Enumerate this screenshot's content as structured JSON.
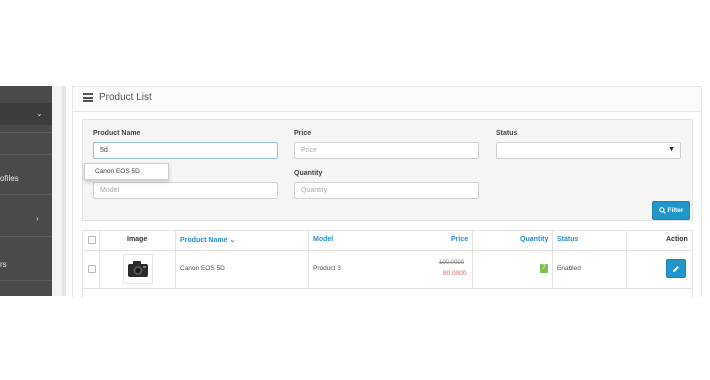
{
  "sidebar": {
    "items": [
      {
        "label": ""
      },
      {
        "label": "ofiles"
      },
      {
        "label": ""
      },
      {
        "label": "rs"
      }
    ]
  },
  "panel": {
    "title": "Product List"
  },
  "filter": {
    "product_name_label": "Product Name",
    "product_name_value": "5d",
    "autocomplete_item": "Canon EOS 5D",
    "model_placeholder": "Model",
    "price_label": "Price",
    "price_placeholder": "Price",
    "quantity_label": "Quantity",
    "quantity_placeholder": "Quantity",
    "status_label": "Status",
    "status_value": "",
    "filter_button": "Filter"
  },
  "table": {
    "headers": {
      "image": "Image",
      "product_name": "Product Name",
      "model": "Model",
      "price": "Price",
      "quantity": "Quantity",
      "status": "Status",
      "action": "Action"
    },
    "rows": [
      {
        "product_name": "Canon EOS 5D",
        "model": "Product 3",
        "price_old": "100.0000",
        "price_new": "80.0000",
        "quantity": "7",
        "status": "Enabled"
      }
    ]
  },
  "colors": {
    "accent": "#2196c9",
    "link": "#2a8ccf",
    "special_price": "#e25d5d",
    "quantity_badge": "#7cc249"
  }
}
